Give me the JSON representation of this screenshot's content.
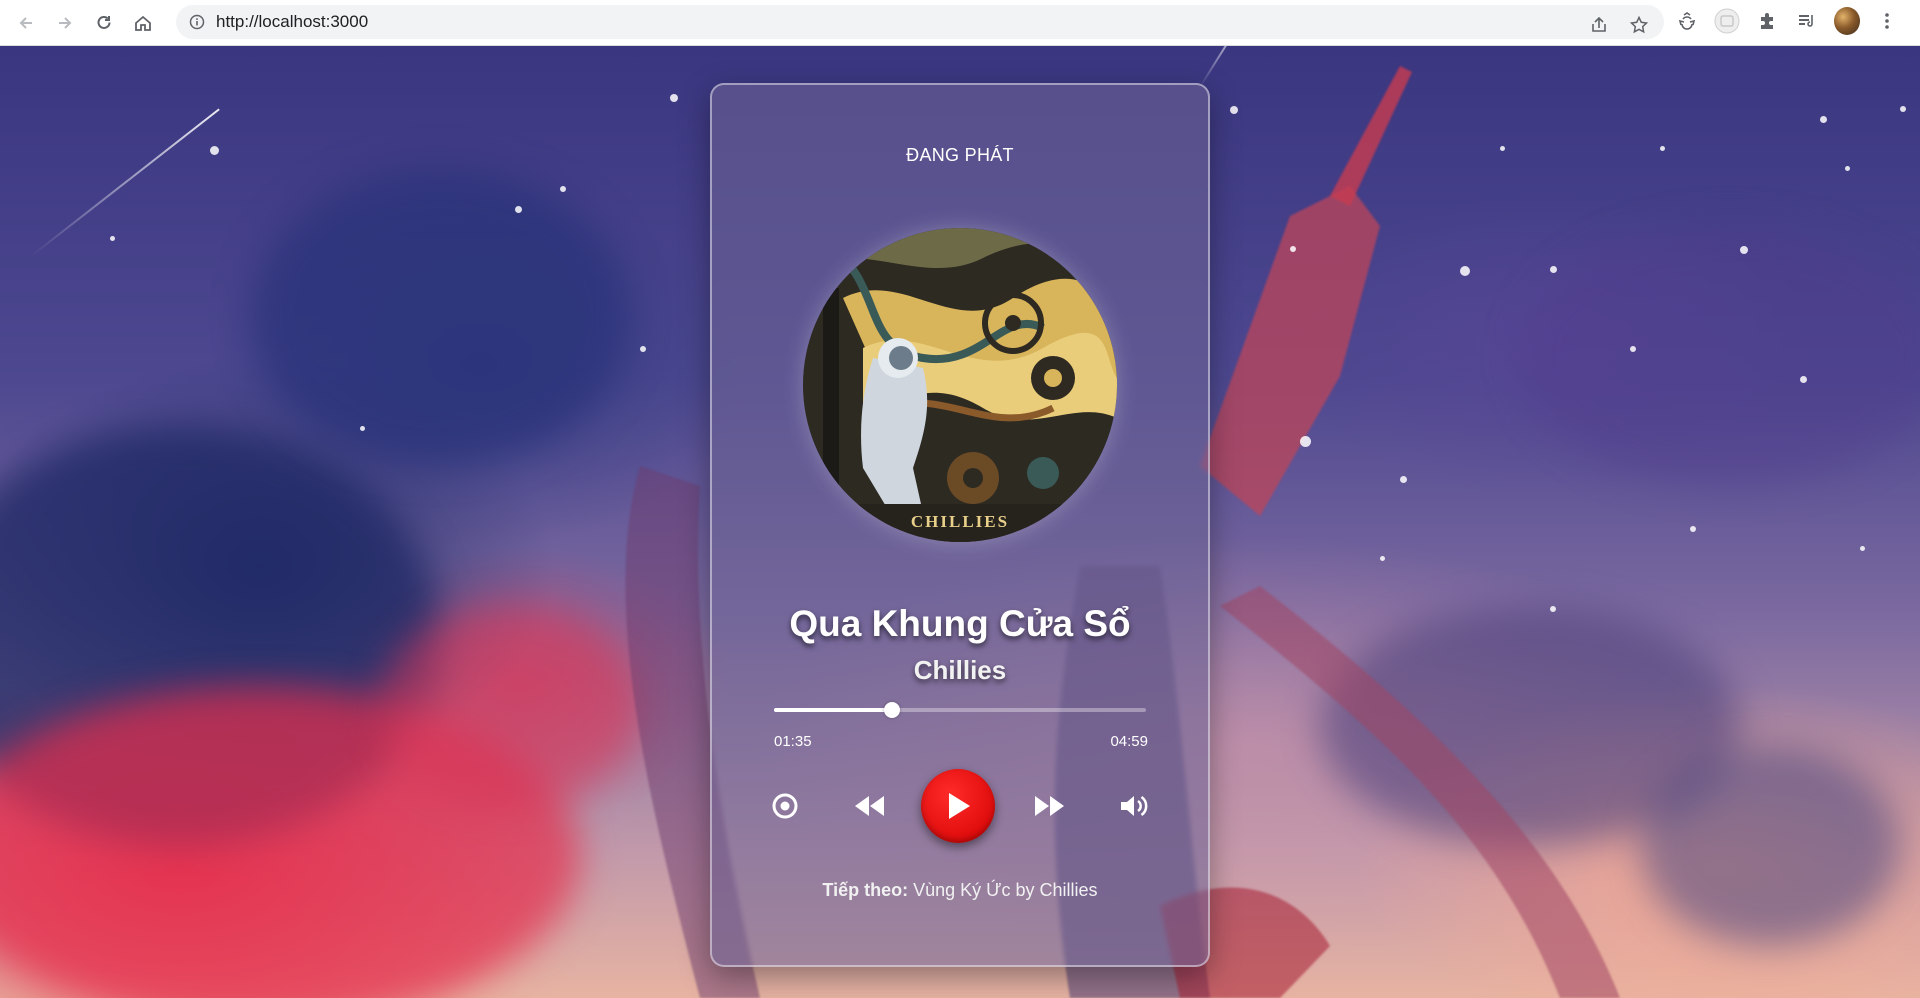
{
  "browser": {
    "url": "http://localhost:3000",
    "icons": [
      "back-icon",
      "forward-icon",
      "reload-icon",
      "home-icon",
      "info-icon",
      "share-icon",
      "star-icon",
      "recycle-icon",
      "extension-badge-icon",
      "puzzle-icon",
      "media-queue-icon",
      "profile-avatar",
      "menu-icon"
    ]
  },
  "player": {
    "header": "ĐANG PHÁT",
    "cover_text": "CHILLIES",
    "title": "Qua Khung Cửa Sổ",
    "artist": "Chillies",
    "current_time": "01:35",
    "total_time": "04:59",
    "progress_fraction": 0.318,
    "next_label": "Tiếp theo:",
    "next_track": "Vùng Ký Ức by Chillies",
    "controls": [
      "repeat-icon",
      "rewind-icon",
      "play-icon",
      "fast-forward-icon",
      "volume-icon"
    ],
    "colors": {
      "play_button": "#e00000",
      "accent": "#ffffff"
    }
  }
}
